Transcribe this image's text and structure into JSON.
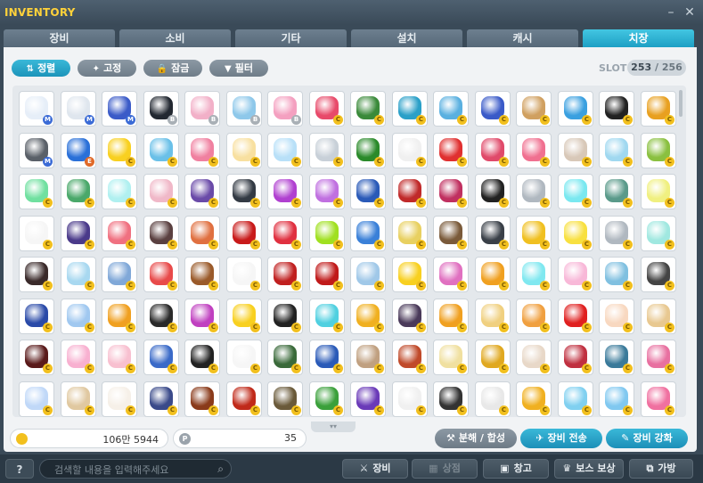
{
  "window": {
    "title": "INVENTORY",
    "minimize_glyph": "–",
    "close_glyph": "✕"
  },
  "tabs": [
    {
      "label": "장비",
      "active": false
    },
    {
      "label": "소비",
      "active": false
    },
    {
      "label": "기타",
      "active": false
    },
    {
      "label": "설치",
      "active": false
    },
    {
      "label": "캐시",
      "active": false
    },
    {
      "label": "치장",
      "active": true
    }
  ],
  "filters": [
    {
      "label": "정렬",
      "icon": "sort-icon",
      "glyph": "⇅",
      "active": true
    },
    {
      "label": "고정",
      "icon": "pin-icon",
      "glyph": "✦",
      "active": false
    },
    {
      "label": "잠금",
      "icon": "lock-icon",
      "glyph": "🔒",
      "active": false
    },
    {
      "label": "필터",
      "icon": "filter-icon",
      "glyph": "▼",
      "active": false
    }
  ],
  "slot": {
    "label": "SLOT",
    "used": "253",
    "separator": "/",
    "total": "256"
  },
  "grid": {
    "badge_letters": {
      "c": "C",
      "m": "M",
      "s": "B",
      "e": "E"
    },
    "rows": [
      [
        "#e6eef8:m",
        "#dfe6ee:m",
        "#3b5bc8:m",
        "#222831:s",
        "#f2b0c8:s",
        "#8ec8ea:s",
        "#f4a0c0:s",
        "#e84a6a:c",
        "#3a8a3a:c",
        "#2aa0c8:c",
        "#5ab0e0:c",
        "#3a5ac8:c",
        "#d0a060:c",
        "#3aa0e0:c",
        "#222222:c",
        "#e8a020:c"
      ],
      [
        "#5a6068:m",
        "#2a70d8:e",
        "#f8d020:c",
        "#6ac0e8:c",
        "#f080a0:c",
        "#f8e0a0:c",
        "#b8e0f8:c",
        "#c8d0d8:c",
        "#2a8a2a:c",
        "#f0f0f0:c",
        "#e03030:c",
        "#e04a6a:c",
        "#f07090:c",
        "#d8c8b8:c",
        "#a0d8f0:c",
        "#8ac040:c"
      ],
      [
        "#70e0a0:c",
        "#4aa86a:c",
        "#b0f0f0:c",
        "#f0b8c8:c",
        "#6a4aa8:c",
        "#333a44:c",
        "#b040d0:c",
        "#c070e0:c",
        "#2a5ab8:c",
        "#c02a2a:c",
        "#c03060:c",
        "#222222:c",
        "#b0b8c0:c",
        "#7ae8f0:c",
        "#5a9a8a:c",
        "#f0f080:c"
      ],
      [
        "#f6f6f6:c",
        "#4a3a8a:c",
        "#f07080:c",
        "#5a4040:c",
        "#e07040:c",
        "#c81a1a:c",
        "#e03040:c",
        "#a0e020:c",
        "#3a80d8:c",
        "#e8d060:c",
        "#7a5a3a:c",
        "#3a4048:c",
        "#f0c020:c",
        "#f8e040:c",
        "#b0b8c0:c",
        "#a0e8e0:c"
      ],
      [
        "#3a2a2a:c",
        "#a8d8f0:c",
        "#80a8d8:c",
        "#e84a4a:c",
        "#9a5a2a:c",
        "#f6f6f6:c",
        "#c02020:c",
        "#c01a1a:c",
        "#a0c8e8:c",
        "#f8d020:c",
        "#e070c0:c",
        "#f0a020:c",
        "#80e8f0:c",
        "#f8b8d8:c",
        "#80c0e0:c",
        "#444444:c"
      ],
      [
        "#2a4aa8:c",
        "#a0c8f0:c",
        "#f0a020:c",
        "#2a2a2a:c",
        "#c040c0:c",
        "#f8d020:c",
        "#222222:c",
        "#50d0e0:c",
        "#f0b020:c",
        "#4a3a5a:c",
        "#f0a020:c",
        "#f0d080:c",
        "#f0a040:c",
        "#e02020:c",
        "#f8d8c0:c",
        "#e8c890:c"
      ],
      [
        "#5a1a1a:c",
        "#f8b0d0:c",
        "#f8c0d0:c",
        "#3a6ac8:c",
        "#222222:c",
        "#f6f6f6:c",
        "#3a6a3a:c",
        "#2a5ab8:c",
        "#c0a080:c",
        "#c04a2a:c",
        "#f0e0a0:c",
        "#e0a820:c",
        "#e8d8c8:c",
        "#c03040:c",
        "#3a7a9a:c",
        "#e870a0:c"
      ],
      [
        "#c0d8f8:c",
        "#e0c8a0:c",
        "#f6f0e8:c",
        "#3a4a8a:c",
        "#8a3a1a:c",
        "#c02a1a:c",
        "#6a5a3a:c",
        "#3aa03a:c",
        "#6a3ab8:c",
        "#f0f0f0:c",
        "#333333:c",
        "#e8e8e8:c",
        "#f0b020:c",
        "#80d0f0:c",
        "#80c8f0:c",
        "#f070a0:c"
      ]
    ]
  },
  "footer": {
    "meso_value": "106만 5944",
    "points_icon": "P",
    "points_value": "35",
    "more_glyph": "▾▾",
    "buttons": [
      {
        "label": "분해 / 합성",
        "glyph": "⚒"
      },
      {
        "label": "장비 전송",
        "glyph": "✈"
      },
      {
        "label": "장비 강화",
        "glyph": "✎"
      }
    ]
  },
  "bottom": {
    "help_label": "?",
    "search_placeholder": "검색할 내용을 입력해주세요",
    "search_glyph": "⌕",
    "buttons": [
      {
        "label": "장비",
        "glyph": "⚔",
        "enabled": true
      },
      {
        "label": "상점",
        "glyph": "▦",
        "enabled": false
      },
      {
        "label": "창고",
        "glyph": "▣",
        "enabled": true
      },
      {
        "label": "보스 보상",
        "glyph": "♛",
        "enabled": true
      },
      {
        "label": "가방",
        "glyph": "⧉",
        "enabled": true
      }
    ]
  }
}
